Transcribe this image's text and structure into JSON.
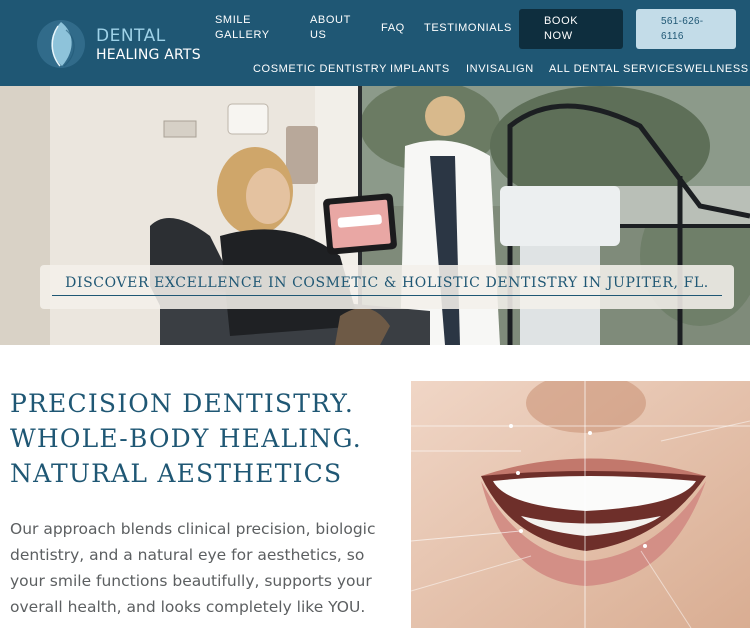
{
  "brand": {
    "name_line1": "DENTAL",
    "name_line2": "HEALING ARTS",
    "logo_icon": "leaf-drop-icon"
  },
  "top_nav": {
    "smile_gallery_l1": "SMILE",
    "smile_gallery_l2": "GALLERY",
    "about_l1": "ABOUT",
    "about_l2": "US",
    "faq": "FAQ",
    "testimonials": "TESTIMONIALS",
    "book_l1": "BOOK",
    "book_l2": "NOW",
    "phone_l1": "561-626-",
    "phone_l2": "6116"
  },
  "main_nav": {
    "items": [
      "COSMETIC DENTISTRY",
      "IMPLANTS",
      "INVISALIGN",
      "ALL DENTAL SERVICES",
      "WELLNESS"
    ]
  },
  "hero": {
    "banner_text": "DISCOVER EXCELLENCE IN COSMETIC & HOLISTIC DENTISTRY IN JUPITER, FL."
  },
  "intro": {
    "headline_lines": [
      "PRECISION DENTISTRY.",
      "WHOLE-BODY HEALING.",
      "NATURAL AESTHETICS"
    ],
    "body": "Our approach blends clinical precision, biologic dentistry, and a natural eye for aesthetics, so your smile functions beautifully, supports your overall health, and looks completely like YOU."
  },
  "colors": {
    "header_bg": "#1f5774",
    "book_button_bg": "#0e2e3e",
    "phone_button_bg": "#c3dce8",
    "accent_text": "#1f5774",
    "body_text": "#5c5f61"
  }
}
